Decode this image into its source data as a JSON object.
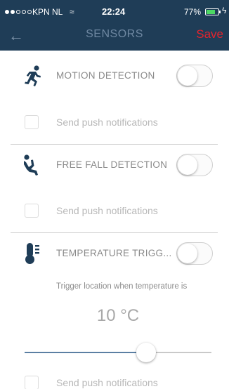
{
  "status_bar": {
    "carrier": "KPN NL",
    "wifi_glyph": "≈",
    "time": "22:24",
    "battery_percent": "77%",
    "battery_level": 0.77,
    "charging_glyph": "ϟ",
    "signal_bars": 2
  },
  "navbar": {
    "back_glyph": "←",
    "title": "SENSORS",
    "save_label": "Save"
  },
  "sensors": [
    {
      "title": "MOTION DETECTION",
      "icon": "running-person-icon",
      "enabled": false,
      "push_label": "Send push notifications"
    },
    {
      "title": "FREE FALL DETECTION",
      "icon": "falling-person-icon",
      "enabled": false,
      "push_label": "Send push notifications"
    },
    {
      "title": "TEMPERATURE TRIGG...",
      "icon": "thermometer-icon",
      "enabled": false,
      "push_label": "Send push notifications"
    }
  ],
  "temperature": {
    "description": "Trigger location when temperature is",
    "value_label": "10 °C",
    "slider_fraction": 0.65
  },
  "colors": {
    "header_bg": "#1f3d57",
    "save": "#e3232d",
    "accent": "#5b7fa3"
  }
}
